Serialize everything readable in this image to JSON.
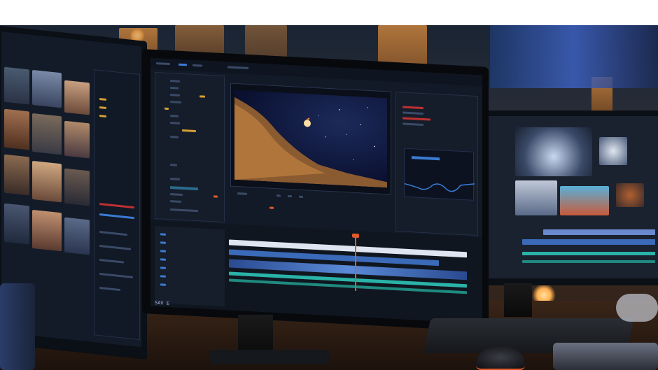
{
  "scene": {
    "description_tags": [
      "video-editing-workstation",
      "three-monitors",
      "timeline",
      "video-preview"
    ],
    "colors": {
      "accent_blue": "#3a7bd5",
      "warm_light": "#ffb050",
      "timeline_teal": "#2ab3a8",
      "marker_orange": "#e05a2a"
    }
  },
  "center_monitor": {
    "footer_text": "SAV E"
  }
}
